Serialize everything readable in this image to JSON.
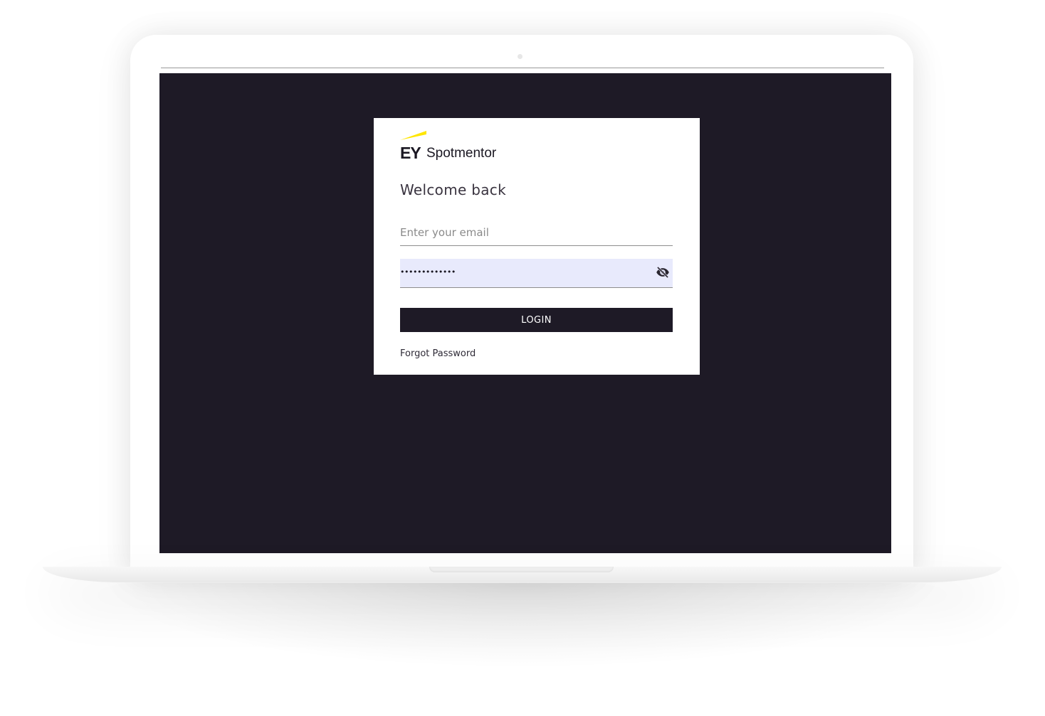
{
  "colors": {
    "screen_background": "#1e1a26",
    "logo_accent": "#ffe600",
    "password_background": "#e8eafc",
    "button_background": "#1e1a26"
  },
  "logo": {
    "brand": "EY",
    "product": "Spotmentor"
  },
  "login": {
    "heading": "Welcome back",
    "email_placeholder": "Enter your email",
    "password_value": "•••••••••••••",
    "password_toggle_icon": "eye-off-icon",
    "button_label": "LOGIN",
    "forgot_password_label": "Forgot Password"
  }
}
